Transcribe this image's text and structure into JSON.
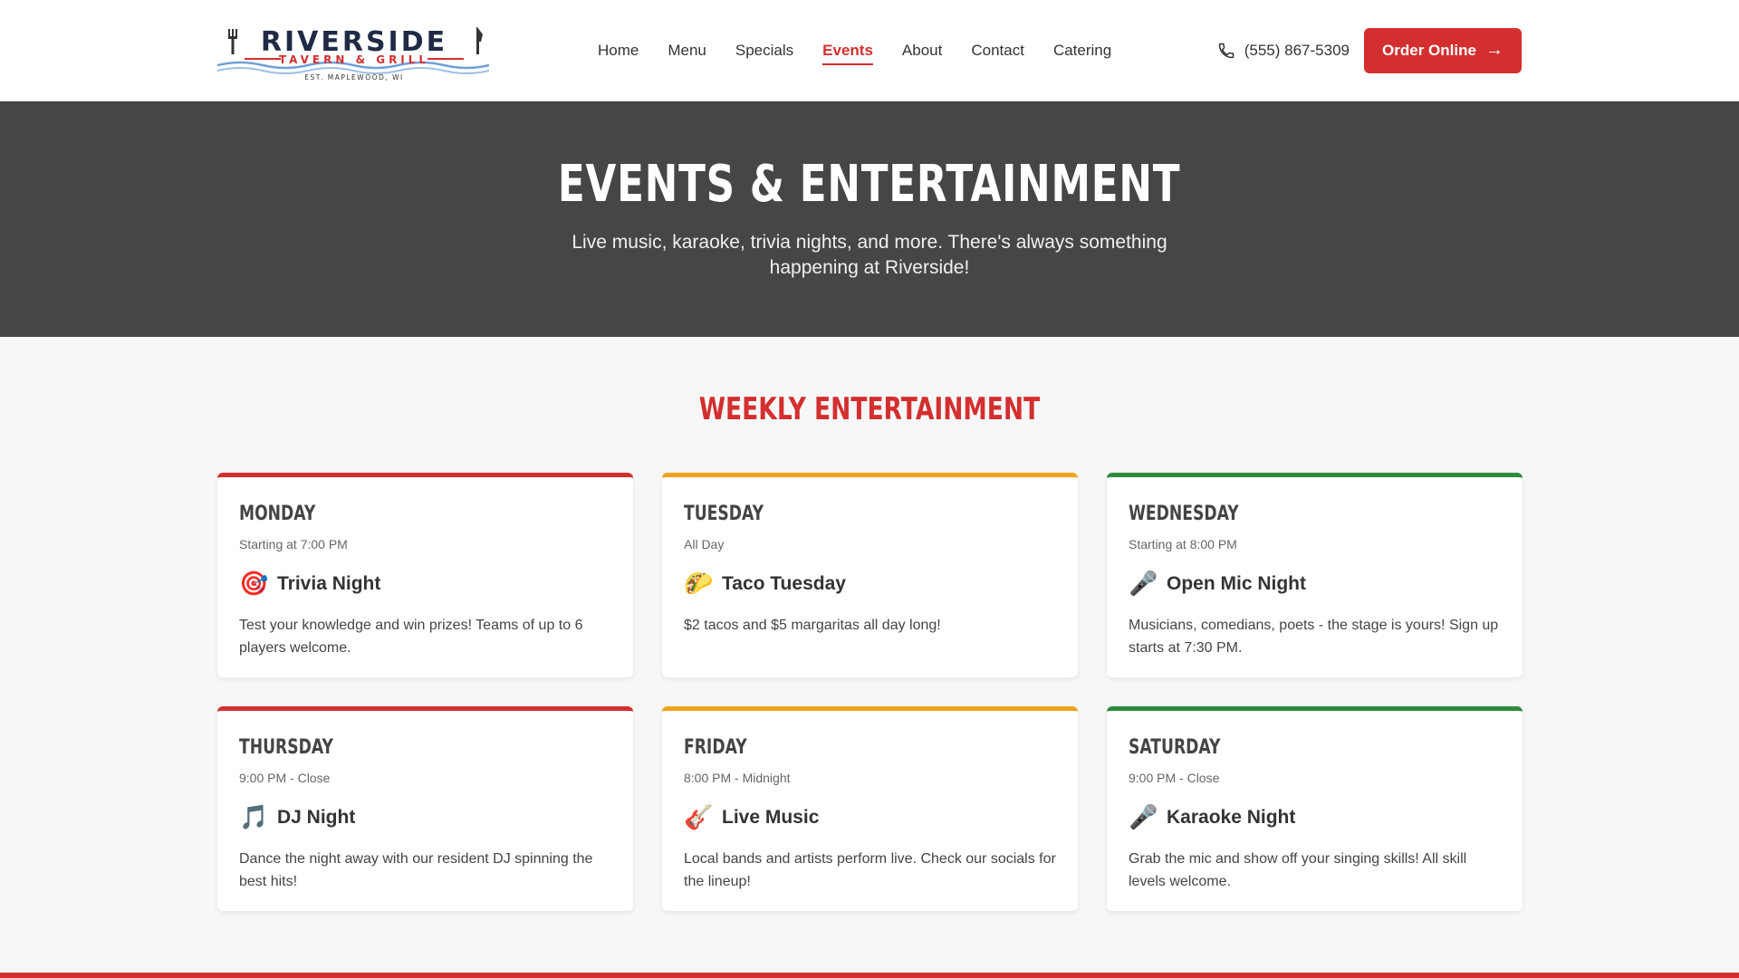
{
  "brand": {
    "name": "RIVERSIDE",
    "subtitle": "TAVERN & GRILL",
    "est": "EST. MAPLEWOOD, WI"
  },
  "nav": {
    "items": [
      "Home",
      "Menu",
      "Specials",
      "Events",
      "About",
      "Contact",
      "Catering"
    ],
    "active": "Events"
  },
  "header": {
    "phone": "(555) 867-5309",
    "order_label": "Order Online"
  },
  "hero": {
    "title": "Events & Entertainment",
    "subtitle": "Live music, karaoke, trivia nights, and more. There's always something happening at Riverside!"
  },
  "weekly": {
    "title": "Weekly Entertainment",
    "cards": [
      {
        "day": "Monday",
        "time": "Starting at 7:00 PM",
        "icon": "🎯",
        "icon_name": "target-icon",
        "event": "Trivia Night",
        "desc": "Test your knowledge and win prizes! Teams of up to 6 players welcome.",
        "accent": "#d32f2f"
      },
      {
        "day": "Tuesday",
        "time": "All Day",
        "icon": "🌮",
        "icon_name": "taco-icon",
        "event": "Taco Tuesday",
        "desc": "$2 tacos and $5 margaritas all day long!",
        "accent": "#f0a319"
      },
      {
        "day": "Wednesday",
        "time": "Starting at 8:00 PM",
        "icon": "🎤",
        "icon_name": "microphone-icon",
        "event": "Open Mic Night",
        "desc": "Musicians, comedians, poets - the stage is yours! Sign up starts at 7:30 PM.",
        "accent": "#2f8a3e"
      },
      {
        "day": "Thursday",
        "time": "9:00 PM - Close",
        "icon": "🎵",
        "icon_name": "music-note-icon",
        "event": "DJ Night",
        "desc": "Dance the night away with our resident DJ spinning the best hits!",
        "accent": "#d32f2f"
      },
      {
        "day": "Friday",
        "time": "8:00 PM - Midnight",
        "icon": "🎸",
        "icon_name": "guitar-icon",
        "event": "Live Music",
        "desc": "Local bands and artists perform live. Check our socials for the lineup!",
        "accent": "#f0a319"
      },
      {
        "day": "Saturday",
        "time": "9:00 PM - Close",
        "icon": "🎤",
        "icon_name": "microphone-icon",
        "event": "Karaoke Night",
        "desc": "Grab the mic and show off your singing skills! All skill levels welcome.",
        "accent": "#2f8a3e"
      }
    ]
  },
  "colors": {
    "brand_red": "#d32f2f",
    "hero_bg": "#464646",
    "accent_yellow": "#f0a319",
    "accent_green": "#2f8a3e"
  }
}
